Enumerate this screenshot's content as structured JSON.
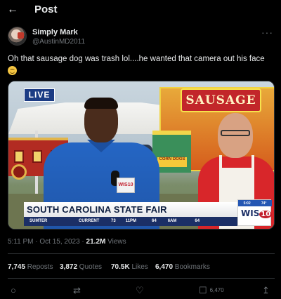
{
  "header": {
    "title": "Post",
    "back_icon": "←"
  },
  "author": {
    "display_name": "Simply Mark",
    "handle": "@AustinMD2011",
    "more_icon": "···"
  },
  "tweet": {
    "text": "Oh that sausage dog was trash lol....he wanted that camera out his face",
    "emoji": "grinning-face-emoji"
  },
  "video": {
    "live_badge": "LIVE",
    "stand_sign": "SAUSAGE",
    "corn_sign": "CORN DOGS",
    "mic_flag": "WIS10",
    "lower_third_title": "SOUTH CAROLINA STATE FAIR",
    "ticker": {
      "location": "SUMTER",
      "current_label": "CURRENT",
      "current_temp": "73",
      "time1": "11PM",
      "temp1": "64",
      "time2": "6AM",
      "temp2": "64"
    },
    "station": {
      "time": "5:02",
      "temp": "74°",
      "logo": "WIS",
      "logo_number": "10"
    }
  },
  "timestamp": {
    "time": "5:11 PM · Oct 15, 2023 · ",
    "views_count": "21.2M",
    "views_label": " Views"
  },
  "stats": {
    "reposts_count": "7,745",
    "reposts_label": " Reposts",
    "quotes_count": "3,872",
    "quotes_label": " Quotes",
    "likes_count": "70.5K",
    "likes_label": " Likes",
    "bookmarks_count": "6,470",
    "bookmarks_label": " Bookmarks"
  },
  "actions": {
    "reply_icon": "○",
    "repost_icon": "⇄",
    "like_icon": "♡",
    "bookmark_icon": "☐",
    "bookmark_count": "6,470",
    "share_icon": "↥"
  }
}
